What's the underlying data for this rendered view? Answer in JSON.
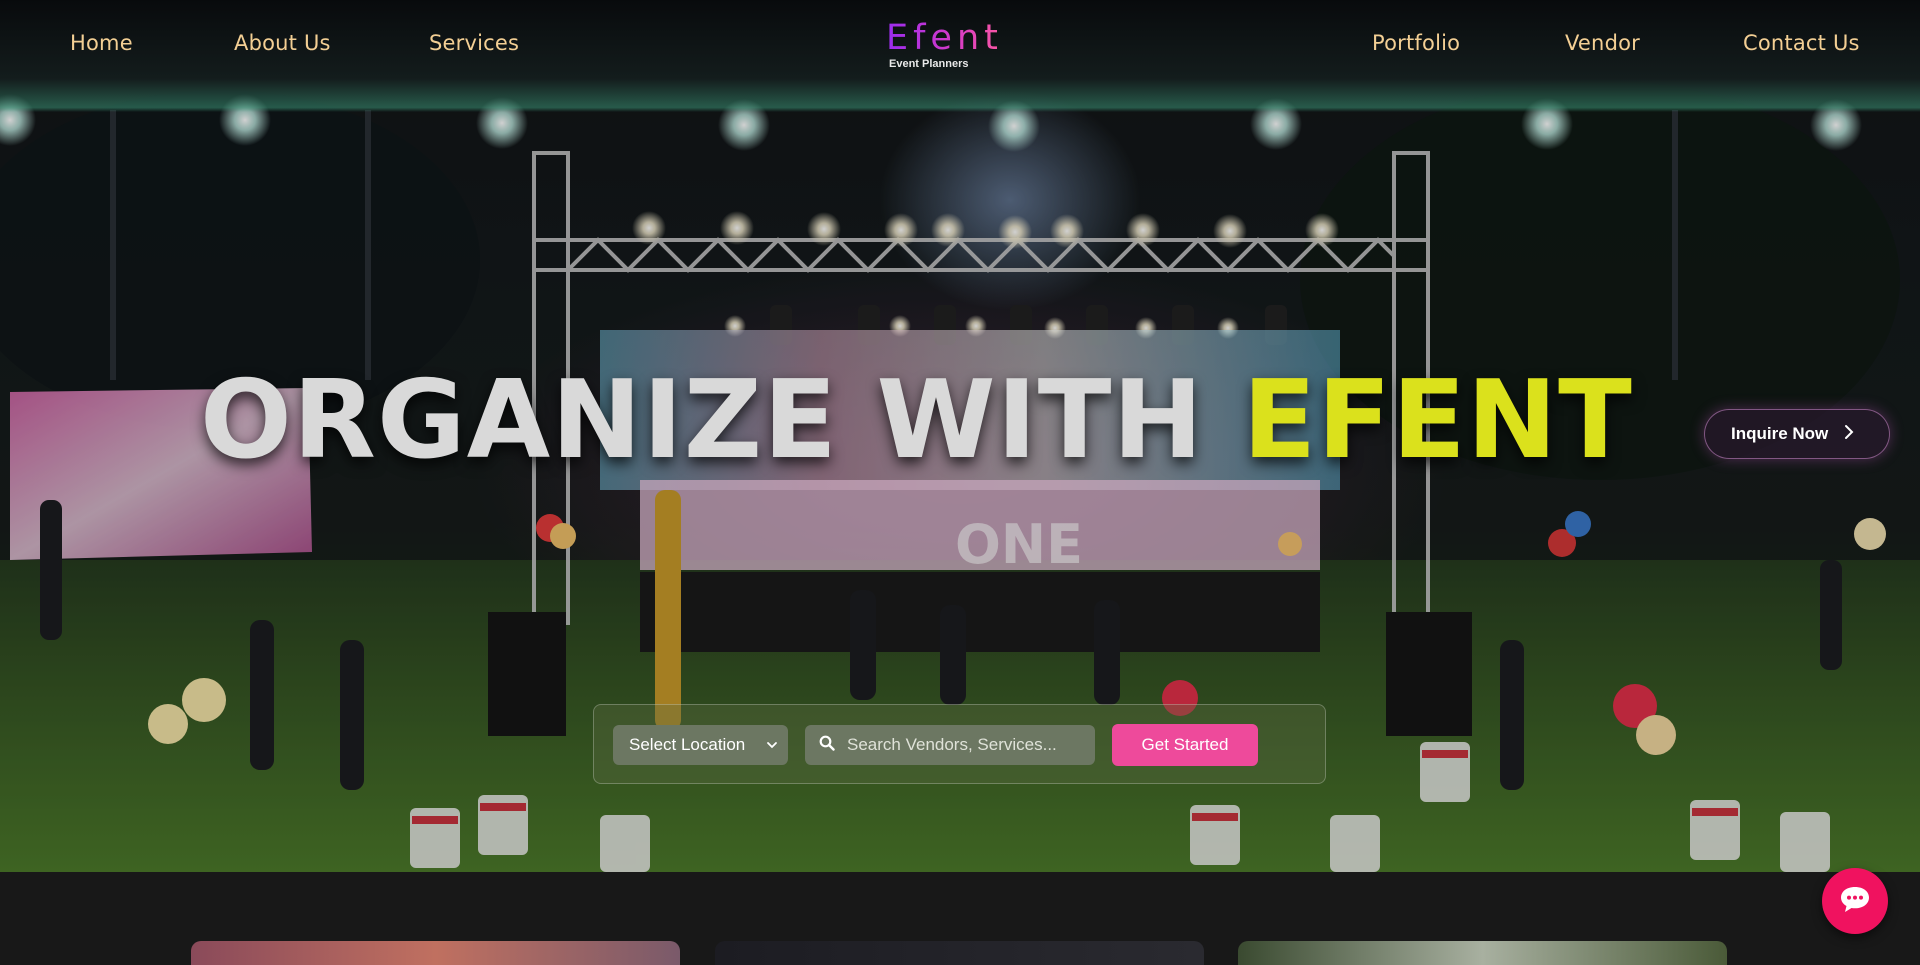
{
  "nav": {
    "left_links": [
      "Home",
      "About Us",
      "Services"
    ],
    "right_links": [
      "Portfolio",
      "Vendor",
      "Contact Us"
    ]
  },
  "logo": {
    "word": "Efent",
    "tagline": "Event Planners"
  },
  "hero": {
    "headline_part1": "ORGANIZE WITH ",
    "headline_part2": "EFENT",
    "stage_sign": "ONE",
    "inquire_label": "Inquire Now"
  },
  "search": {
    "location_selected": "Select Location",
    "input_placeholder": "Search Vendors, Services...",
    "button_label": "Get Started"
  },
  "icons": {
    "inquire": "chevron-right-icon",
    "select": "chevron-down-icon",
    "search": "search-icon",
    "chat": "chat-bubble-icon"
  },
  "colors": {
    "nav_link": "#f3cf94",
    "logo_gradient_start": "#9b2cf0",
    "logo_gradient_end": "#ff5aa0",
    "headline_white": "#d9d9d9",
    "headline_yellow": "#dbe11c",
    "cta_pink": "#ee4a9b",
    "chat_red": "#f0125f",
    "page_bg": "#181818"
  }
}
